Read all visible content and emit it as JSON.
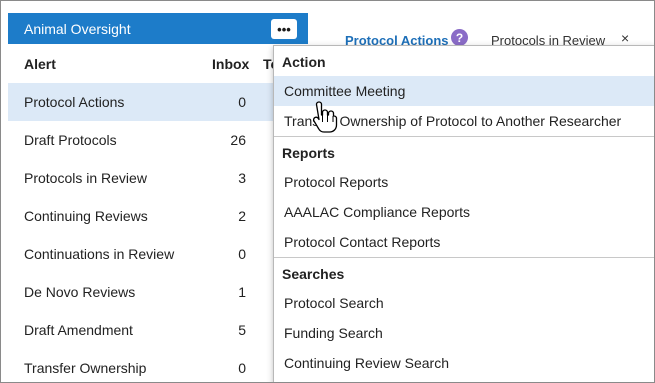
{
  "panel": {
    "title": "Animal Oversight",
    "more_label": "•••",
    "columns": {
      "alert": "Alert",
      "inbox": "Inbox",
      "total": "To"
    },
    "rows": [
      {
        "name": "Protocol Actions",
        "inbox": "0"
      },
      {
        "name": "Draft Protocols",
        "inbox": "26"
      },
      {
        "name": "Protocols in Review",
        "inbox": "3"
      },
      {
        "name": "Continuing Reviews",
        "inbox": "2"
      },
      {
        "name": "Continuations in Review",
        "inbox": "0"
      },
      {
        "name": "De Novo Reviews",
        "inbox": "1"
      },
      {
        "name": "Draft Amendment",
        "inbox": "5"
      },
      {
        "name": "Transfer Ownership",
        "inbox": "0"
      }
    ]
  },
  "tabs": {
    "active": "Protocol Actions",
    "help_icon": "?",
    "second": "Protocols in Review",
    "close": "×"
  },
  "menu": {
    "sections": [
      {
        "title": "Action",
        "items": [
          "Committee Meeting",
          "Transfer Ownership of Protocol to Another Researcher"
        ]
      },
      {
        "title": "Reports",
        "items": [
          "Protocol Reports",
          "AAALAC Compliance Reports",
          "Protocol Contact Reports"
        ]
      },
      {
        "title": "Searches",
        "items": [
          "Protocol Search",
          "Funding Search",
          "Continuing Review Search"
        ]
      }
    ]
  },
  "colors": {
    "header_blue": "#1d7cc9",
    "selected_row": "#dce9f7",
    "help_purple": "#8a6cc7"
  },
  "icons": {
    "more": "ellipsis-icon",
    "help": "help-icon",
    "close": "close-icon",
    "cursor": "hand-pointer-icon"
  }
}
